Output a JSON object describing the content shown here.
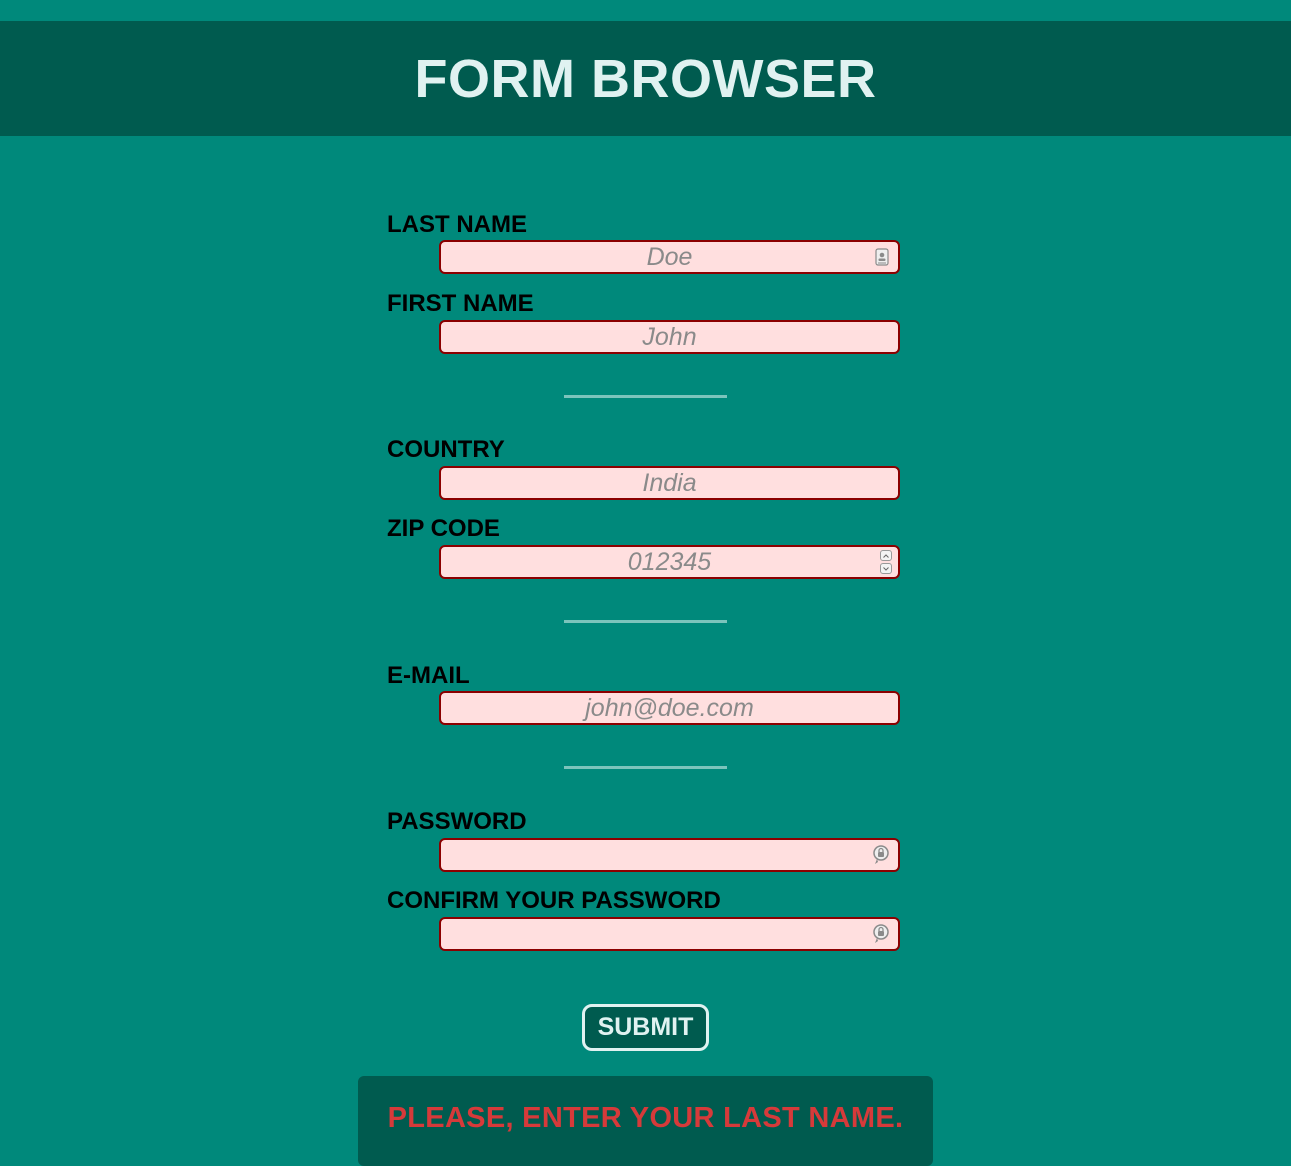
{
  "header": {
    "title": "FORM BROWSER"
  },
  "fields": {
    "last_name": {
      "label": "LAST NAME",
      "placeholder": "Doe",
      "icon": "contact-card-icon"
    },
    "first_name": {
      "label": "FIRST NAME",
      "placeholder": "John"
    },
    "country": {
      "label": "COUNTRY",
      "placeholder": "India"
    },
    "zip_code": {
      "label": "ZIP CODE",
      "placeholder": "012345",
      "icon": "number-spinner-icon"
    },
    "email": {
      "label": "E-MAIL",
      "placeholder": "john@doe.com"
    },
    "password": {
      "label": "PASSWORD",
      "placeholder": "",
      "icon": "password-key-icon"
    },
    "confirm_password": {
      "label": "CONFIRM YOUR PASSWORD",
      "placeholder": "",
      "icon": "password-key-icon"
    }
  },
  "submit": {
    "label": "SUBMIT"
  },
  "error": {
    "message": "PLEASE, ENTER YOUR LAST NAME."
  },
  "colors": {
    "background": "#00897b",
    "header": "#005b4f",
    "field_bg": "#ffdfdf",
    "field_border": "#8b0000",
    "error_text": "#d63a3a"
  }
}
